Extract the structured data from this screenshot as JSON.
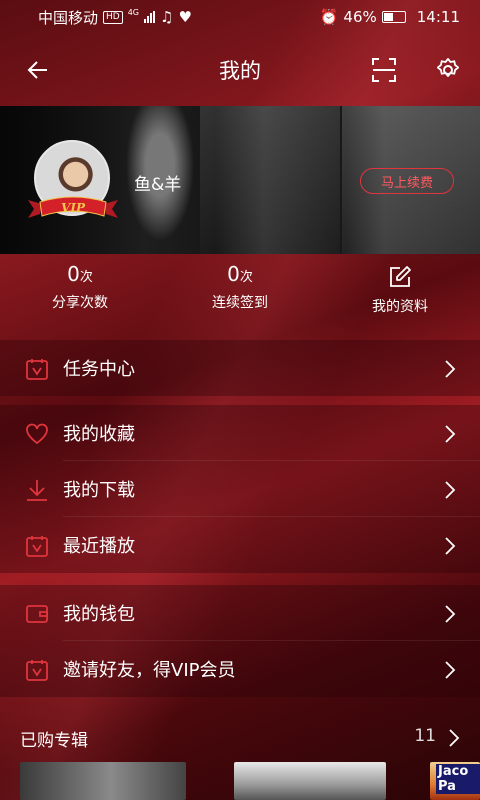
{
  "status_bar": {
    "carrier": "中国移动",
    "hd_badge": "HD",
    "network": "4G",
    "battery": "46%",
    "time": "14:11"
  },
  "header": {
    "title": "我的"
  },
  "profile": {
    "username": "鱼&羊",
    "vip_badge": "VIP",
    "renew_label": "马上续费"
  },
  "stats": [
    {
      "value": "0",
      "unit": "次",
      "label": "分享次数"
    },
    {
      "value": "0",
      "unit": "次",
      "label": "连续签到"
    },
    {
      "label": "我的资料"
    }
  ],
  "menu": {
    "task_center": "任务中心",
    "favorites": "我的收藏",
    "downloads": "我的下载",
    "recent": "最近播放",
    "wallet": "我的钱包",
    "invite": "邀请好友，得VIP会员"
  },
  "purchased": {
    "title": "已购专辑",
    "count": "11",
    "albums": [
      {
        "label": ""
      },
      {
        "label": ""
      },
      {
        "label": "Jaco Pa"
      }
    ]
  },
  "colors": {
    "accent": "#e0353d",
    "background": "#6a0f15"
  }
}
